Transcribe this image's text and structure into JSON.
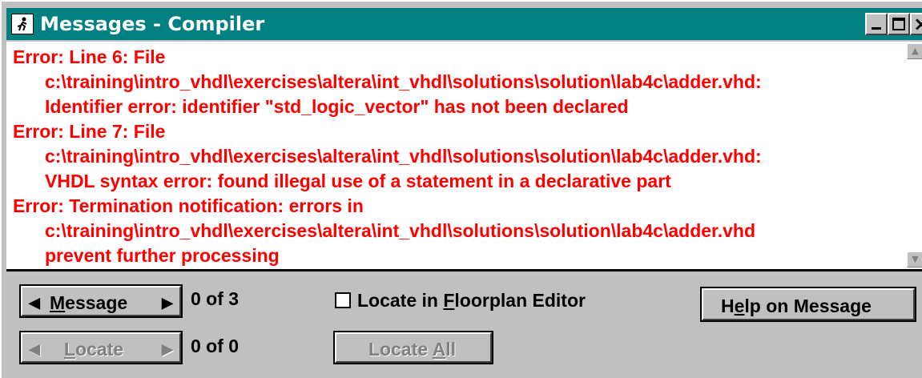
{
  "window": {
    "title": "Messages - Compiler",
    "titlebar_color": "#008080",
    "controls": [
      "minimize-icon",
      "maximize-icon",
      "close-icon"
    ]
  },
  "messages": [
    {
      "first": "Error: Line 6: File",
      "cont": [
        "c:\\training\\intro_vhdl\\exercises\\altera\\int_vhdl\\solutions\\solution\\lab4c\\adder.vhd:",
        "Identifier error: identifier \"std_logic_vector\" has not been declared"
      ]
    },
    {
      "first": "Error: Line 7: File",
      "cont": [
        "c:\\training\\intro_vhdl\\exercises\\altera\\int_vhdl\\solutions\\solution\\lab4c\\adder.vhd:",
        "VHDL syntax error: found illegal use of a statement in a declarative part"
      ]
    },
    {
      "first": "Error: Termination notification: errors in",
      "cont": [
        "c:\\training\\intro_vhdl\\exercises\\altera\\int_vhdl\\solutions\\solution\\lab4c\\adder.vhd",
        "prevent further processing"
      ]
    }
  ],
  "message_color": "#ff0000",
  "controls": {
    "message_button": {
      "accel": "M",
      "rest": "essage",
      "enabled": true
    },
    "message_count": "0 of 3",
    "locate_button": {
      "accel": "L",
      "rest": "ocate",
      "enabled": false
    },
    "locate_count": "0 of 0",
    "floorplan_checkbox": {
      "pre": "Locate in ",
      "accel": "F",
      "post": "loorplan Editor",
      "checked": false
    },
    "help_button": {
      "pre": "H",
      "accel": "e",
      "post": "lp on Message"
    },
    "locate_all_button": {
      "pre": "Locate ",
      "accel": "A",
      "post": "ll",
      "enabled": false
    }
  }
}
